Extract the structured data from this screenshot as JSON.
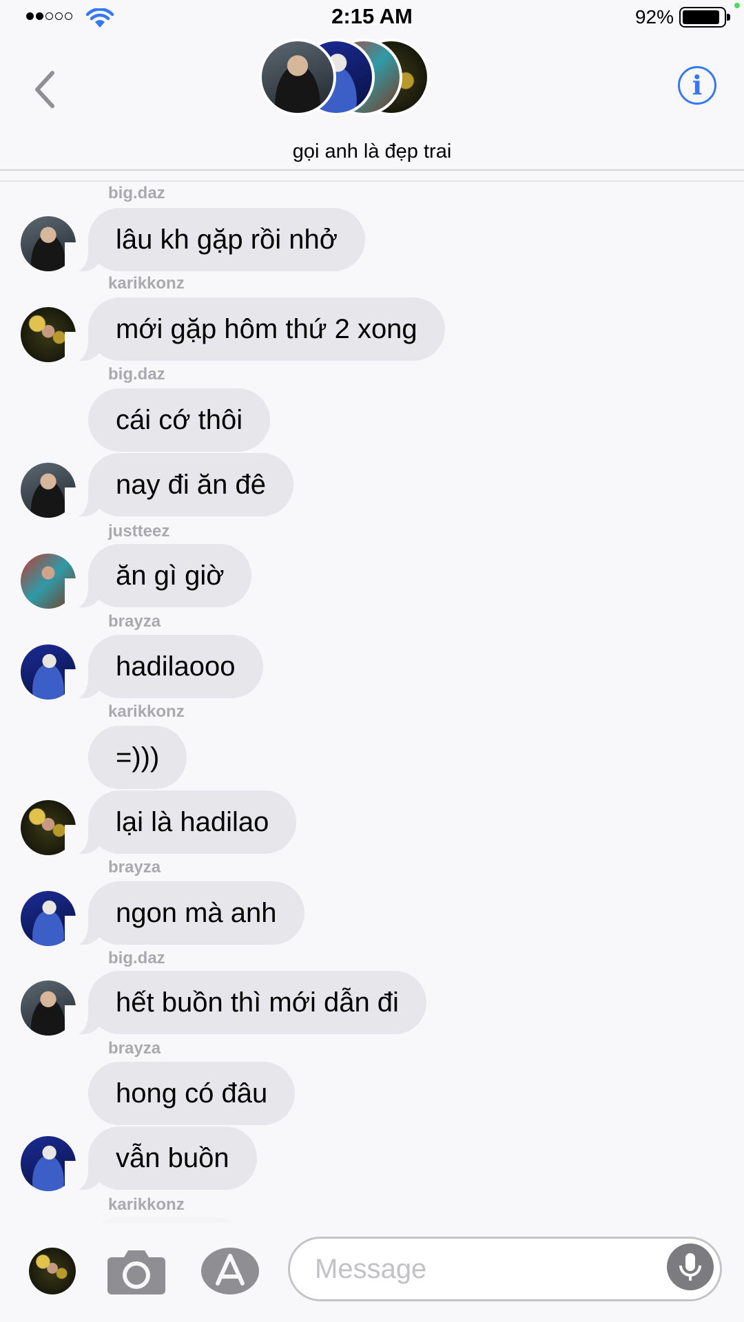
{
  "status_bar": {
    "time": "2:15 AM",
    "battery": "92%"
  },
  "header": {
    "group_name": "gọi anh là đẹp trai",
    "info_icon": "i"
  },
  "messages": [
    {
      "sender": "big.daz",
      "text": "lâu kh gặp rồi nhở"
    },
    {
      "sender": "karikkonz",
      "text": "mới gặp hôm thứ 2 xong"
    },
    {
      "sender": "big.daz",
      "text": "cái cớ thôi"
    },
    {
      "sender": "",
      "text": "nay đi ăn đê"
    },
    {
      "sender": "justteez",
      "text": "ăn gì giờ"
    },
    {
      "sender": "brayza",
      "text": "hadilaooo"
    },
    {
      "sender": "karikkonz",
      "text": "=)))"
    },
    {
      "sender": "",
      "text": "lại là hadilao"
    },
    {
      "sender": "brayza",
      "text": "ngon mà anh"
    },
    {
      "sender": "big.daz",
      "text": "hết buồn thì mới dẫn đi"
    },
    {
      "sender": "brayza",
      "text": "hong có đâu"
    },
    {
      "sender": "",
      "text": "vẫn buồn"
    },
    {
      "sender": "karikkonz",
      "text": ""
    }
  ],
  "input": {
    "placeholder": "Message"
  },
  "icons": {
    "back": "chevron-left-icon",
    "info": "info-icon",
    "camera": "camera-icon",
    "app_store": "app-store-icon",
    "mic": "microphone-icon",
    "wifi": "wifi-icon",
    "battery": "battery-icon"
  },
  "colors": {
    "accent": "#3478f6",
    "bubble": "#e6e6eb",
    "background": "#f8f8fa",
    "sender_text": "#a9a9ae"
  }
}
